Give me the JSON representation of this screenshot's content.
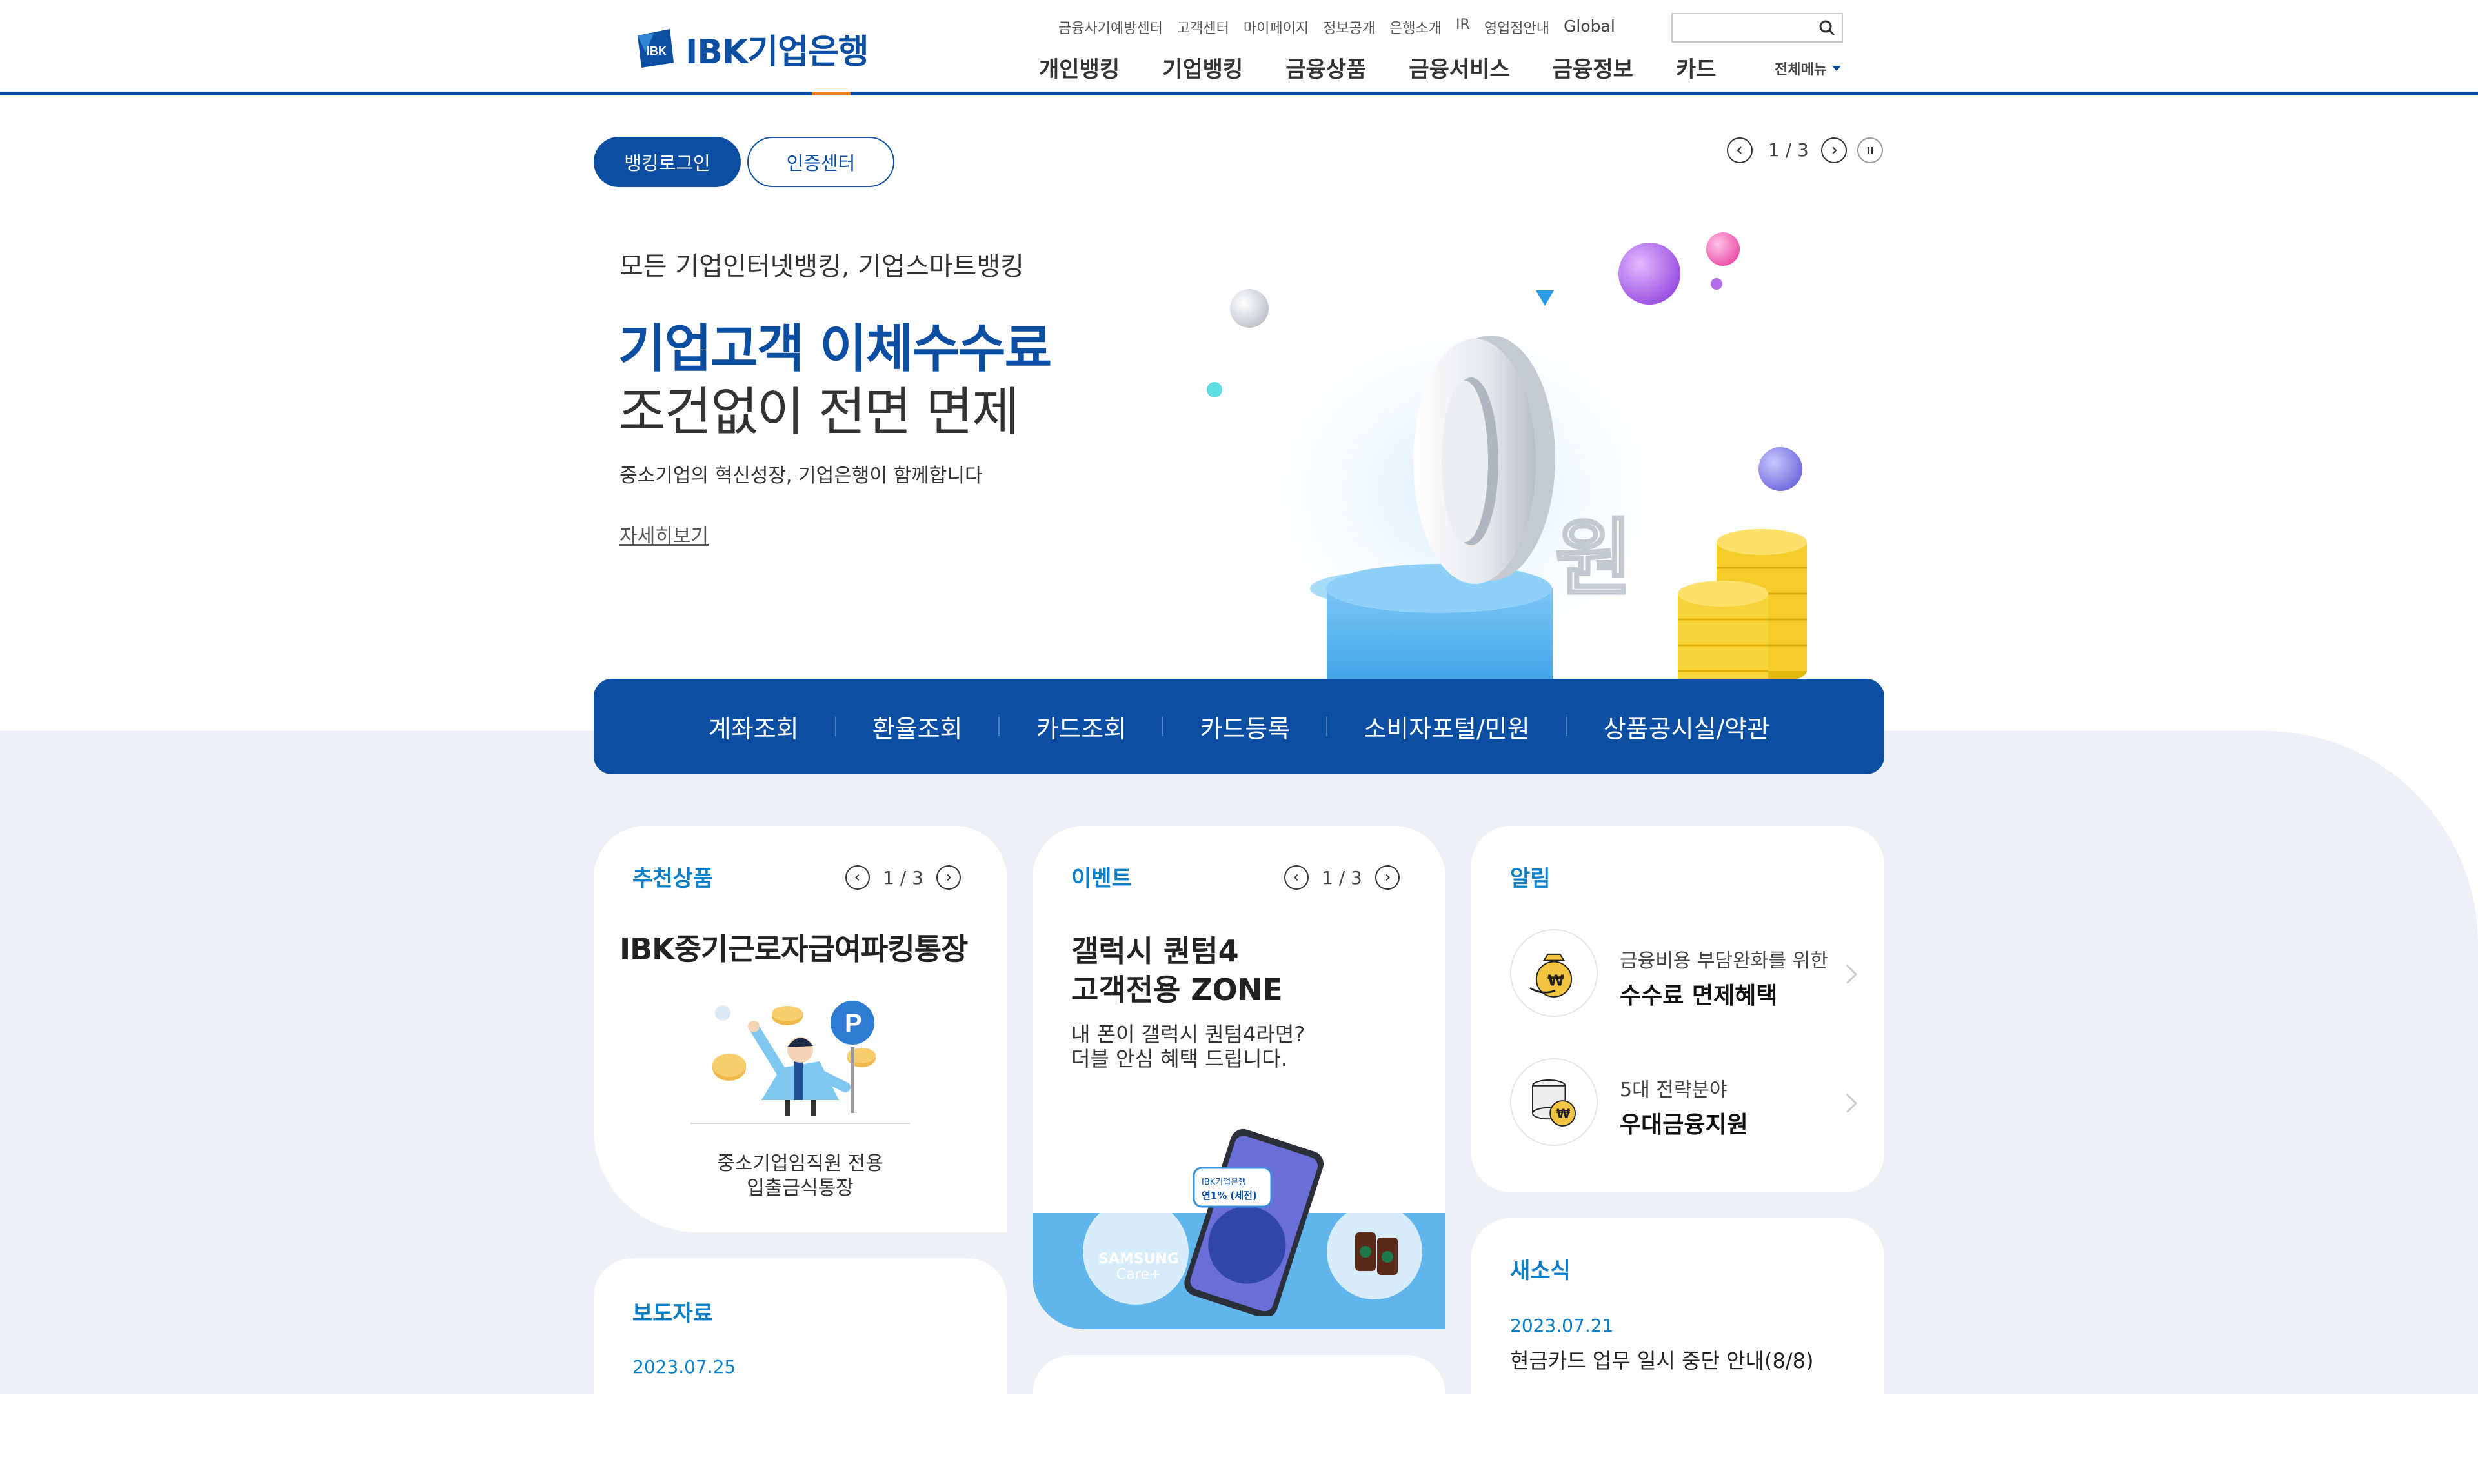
{
  "header": {
    "logo_text": "IBK기업은행",
    "logo_mark_text": "IBK",
    "util_links": [
      "금융사기예방센터",
      "고객센터",
      "마이페이지",
      "정보공개",
      "은행소개",
      "IR",
      "영업점안내"
    ],
    "global_label": "Global",
    "search_placeholder": "",
    "gnb": [
      "개인뱅킹",
      "기업뱅킹",
      "금융상품",
      "금융서비스",
      "금융정보",
      "카드"
    ],
    "all_menu_label": "전체메뉴"
  },
  "hero": {
    "login_button": "뱅킹로그인",
    "cert_button": "인증센터",
    "pager": "1 / 3",
    "subtitle": "모든 기업인터넷뱅킹, 기업스마트뱅킹",
    "title_line1": "기업고객 이체수수료",
    "title_line2": "조건없이 전면 면제",
    "description": "중소기업의 혁신성장, 기업은행이 함께합니다",
    "more_link": "자세히보기",
    "art_big_text": "0",
    "art_won_text": "원"
  },
  "quick_menu": [
    "계좌조회",
    "환율조회",
    "카드조회",
    "카드등록",
    "소비자포털/민원",
    "상품공시실/약관"
  ],
  "recommend": {
    "title": "추천상품",
    "pager": "1 / 3",
    "product_name": "IBK중기근로자급여파킹통장",
    "desc_line1": "중소기업임직원 전용",
    "desc_line2": "입출금식통장",
    "parking_letter": "P"
  },
  "event": {
    "title": "이벤트",
    "pager": "1 / 3",
    "headline1": "갤럭시 퀀텀4",
    "headline2": "고객전용 ZONE",
    "desc1": "내 폰이 갤럭시 퀀텀4라면?",
    "desc2": "더블 안심 혜택 드립니다.",
    "badge_line1": "IBK기업은행",
    "badge_line2": "연1% (세전)",
    "samsung_line1": "SAMSUNG",
    "samsung_line2": "Care+"
  },
  "notice": {
    "title": "알림",
    "items": [
      {
        "small": "금융비용 부담완화를 위한",
        "big": "수수료 면제혜택",
        "icon": "money-bag-icon"
      },
      {
        "small": "5대 전략분야",
        "big": "우대금융지원",
        "icon": "coin-stack-icon"
      }
    ]
  },
  "press": {
    "title": "보도자료",
    "date": "2023.07.25",
    "headline": ""
  },
  "news": {
    "title": "새소식",
    "date": "2023.07.21",
    "headline": "현금카드 업무 일시 중단 안내(8/8)"
  },
  "colors": {
    "brand": "#0b4ea2",
    "accent": "#ef7d22",
    "card_title": "#0b7fc7",
    "background_gray": "#edf1f5"
  }
}
